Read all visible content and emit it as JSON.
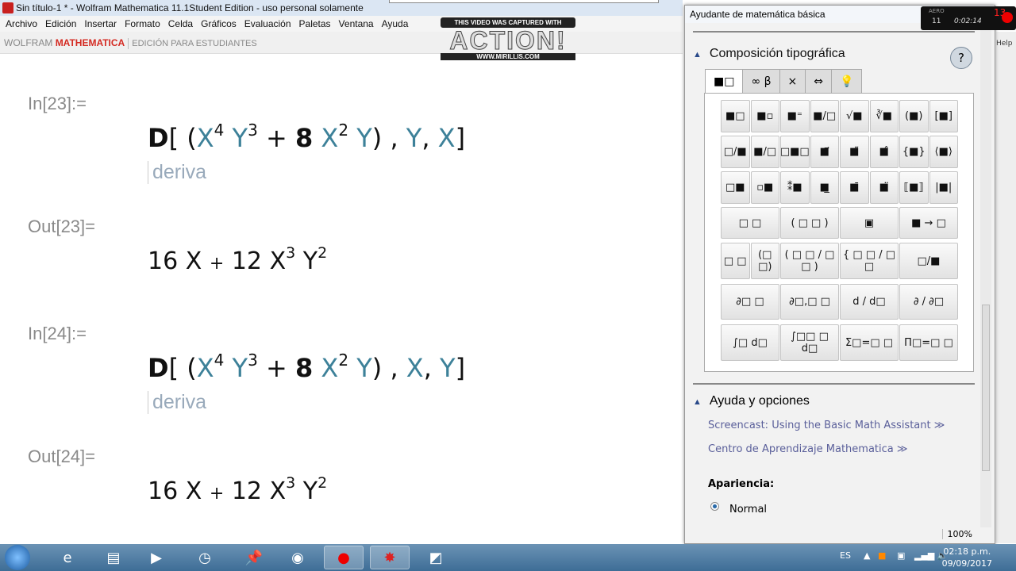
{
  "window": {
    "title": "Sin título-1 * - Wolfram Mathematica 11.1Student Edition - uso personal solamente"
  },
  "menu": [
    "Archivo",
    "Edición",
    "Insertar",
    "Formato",
    "Celda",
    "Gráficos",
    "Evaluación",
    "Paletas",
    "Ventana",
    "Ayuda"
  ],
  "brand": {
    "wolfram": "WOLFRAM",
    "mathematica": "MATHEMATICA",
    "edition": "EDICIÓN PARA ESTUDIANTES"
  },
  "watermark": {
    "caption": "THIS VIDEO WAS CAPTURED WITH",
    "logo": "ACTION!",
    "url": "WWW.MIRILLIS.COM"
  },
  "recorder": {
    "aero": "AERO",
    "fps": "11",
    "count": "13",
    "time": "0:02:14"
  },
  "notebook": {
    "cells": [
      {
        "in_label": "In[23]:=",
        "input": {
          "head": "D",
          "open": "[",
          "p1": "(",
          "x1": "X",
          "e1": "4",
          "y1": "Y",
          "e2": "3",
          "plus": "+",
          "c": "8",
          "x2": "X",
          "e3": "2",
          "y2": "Y",
          "p2": ")",
          "comma1": ",",
          "var1": "Y",
          "comma2": ",",
          "var2": "X",
          "close": "]"
        },
        "hint": "deriva",
        "out_label": "Out[23]=",
        "output": {
          "a": "16",
          "x": "X",
          "plus": "+",
          "b": "12",
          "x2": "X",
          "e1": "3",
          "y": "Y",
          "e2": "2"
        }
      },
      {
        "in_label": "In[24]:=",
        "input": {
          "head": "D",
          "open": "[",
          "p1": "(",
          "x1": "X",
          "e1": "4",
          "y1": "Y",
          "e2": "3",
          "plus": "+",
          "c": "8",
          "x2": "X",
          "e3": "2",
          "y2": "Y",
          "p2": ")",
          "comma1": ",",
          "var1": "X",
          "comma2": ",",
          "var2": "Y",
          "close": "]"
        },
        "hint": "deriva",
        "out_label": "Out[24]=",
        "output": {
          "a": "16",
          "x": "X",
          "plus": "+",
          "b": "12",
          "x2": "X",
          "e1": "3",
          "y": "Y",
          "e2": "2"
        }
      }
    ]
  },
  "side_strip": {
    "help": "Help"
  },
  "palette": {
    "title": "Ayudante de matemática básica",
    "section1": "Composición tipográfica",
    "help_button": "?",
    "tabs": [
      "■□",
      "∞ β",
      "×",
      "⇔",
      "💡"
    ],
    "rows": [
      [
        "■□",
        "■▫",
        "■⁼",
        "■/□",
        "√■",
        "∛■",
        "(■)",
        "[■]"
      ],
      [
        "□/■",
        "■/□",
        "□■□",
        "■⃗",
        "■̃",
        "■̂",
        "{■}",
        "⟨■⟩"
      ],
      [
        "□■",
        "▫■",
        "⁑■",
        "■̲",
        "■̄",
        "■̈",
        "⟦■⟧",
        "|■|"
      ],
      [
        "□  □",
        "( □  □ )",
        "▣",
        "■ → □"
      ],
      [
        "□ □",
        "(□ □)",
        "( □ □ / □ □ )",
        "{ □ □ / □ □",
        "□/■"
      ],
      [
        "∂□ □",
        "∂□,□ □",
        "d / d□",
        "∂ / ∂□"
      ],
      [
        "∫□ d□",
        "∫□□ □ d□",
        "Σ□=□ □",
        "Π□=□ □"
      ]
    ],
    "section2": "Ayuda y opciones",
    "links": [
      "Screencast: Using the Basic Math Assistant ≫",
      "Centro de Aprendizaje Mathematica ≫"
    ],
    "appearance_label": "Apariencia:",
    "appearance_selected": "Normal",
    "zoom": "100%"
  },
  "taskbar": {
    "lang": "ES",
    "time": "02:18 p.m.",
    "date": "09/09/2017"
  }
}
